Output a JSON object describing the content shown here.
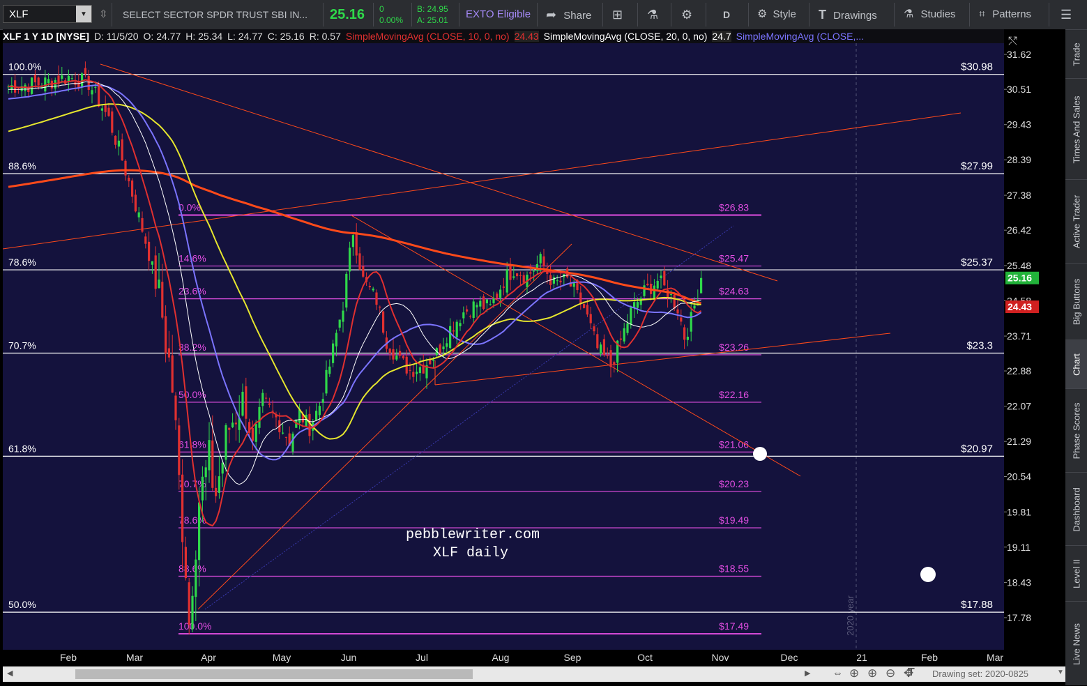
{
  "toolbar": {
    "symbol": "XLF",
    "description": "SELECT SECTOR SPDR TRUST SBI IN...",
    "last": "25.16",
    "change": "0",
    "change_pct": "0.00%",
    "bid": "B: 24.95",
    "ask": "A: 25.01",
    "exto": "EXTO Eligible",
    "share": "Share",
    "interval": "D",
    "style": "Style",
    "drawings": "Drawings",
    "studies": "Studies",
    "patterns": "Patterns",
    "icons": {
      "share": "share-icon",
      "grid": "layout-grid-icon",
      "flask": "flask-icon",
      "gear": "gear-icon",
      "style": "style-icon",
      "drawings": "drawing-tool-icon",
      "studies": "studies-flask-icon",
      "patterns": "patterns-icon",
      "menu": "hamburger-menu-icon"
    }
  },
  "infobar": {
    "title": "XLF 1 Y 1D [NYSE]",
    "date": "D: 11/5/20",
    "open": "O: 24.77",
    "high": "H: 25.34",
    "low": "L: 24.77",
    "close": "C: 25.16",
    "range": "R: 0.57",
    "sma10": "SimpleMovingAvg (CLOSE, 10, 0, no)",
    "sma10_value": "24.43",
    "sma20": "SimpleMovingAvg (CLOSE, 20, 0, no)",
    "sma20_value": "24.7",
    "sma_other": "SimpleMovingAvg (CLOSE,..."
  },
  "sidebar": {
    "tabs": [
      "Trade",
      "Times And Sales",
      "Active Trader",
      "Big Buttons",
      "Chart",
      "Phase Scores",
      "Dashboard",
      "Level II",
      "Live News"
    ],
    "active": "Chart"
  },
  "scrollbar": {
    "drawing_set": "Drawing set: 2020-0825"
  },
  "chart_data": {
    "type": "candlestick",
    "symbol": "XLF",
    "period": "1 Y 1D",
    "y_ticks": [
      31.62,
      30.51,
      29.43,
      28.39,
      27.38,
      26.42,
      25.48,
      24.58,
      23.71,
      22.88,
      22.07,
      21.29,
      20.54,
      19.81,
      19.11,
      18.43,
      17.78
    ],
    "ylim": [
      17.15,
      32.25
    ],
    "x_ticks": [
      "Feb",
      "Mar",
      "Apr",
      "May",
      "Jun",
      "Jul",
      "Aug",
      "Sep",
      "Oct",
      "Nov",
      "Dec",
      "21",
      "Feb",
      "Mar"
    ],
    "x_separator_label": "2020 year",
    "price_tags": {
      "last": "25.16",
      "sma10": "24.43"
    },
    "ohlc_last": {
      "date": "11/5/20",
      "open": 24.77,
      "high": 25.34,
      "low": 24.77,
      "close": 25.16
    },
    "fib_levels_major": [
      {
        "pct": "100.0%",
        "price": "$30.98"
      },
      {
        "pct": "88.6%",
        "price": "$27.99"
      },
      {
        "pct": "78.6%",
        "price": "$25.37"
      },
      {
        "pct": "70.7%",
        "price": "$23.3"
      },
      {
        "pct": "61.8%",
        "price": "$20.97"
      },
      {
        "pct": "50.0%",
        "price": "$17.88"
      }
    ],
    "fib_levels_minor": [
      {
        "pct": "0.0%",
        "price": "$26.83"
      },
      {
        "pct": "14.6%",
        "price": "$25.47"
      },
      {
        "pct": "23.6%",
        "price": "$24.63"
      },
      {
        "pct": "38.2%",
        "price": "$23.26"
      },
      {
        "pct": "50.0%",
        "price": "$22.16"
      },
      {
        "pct": "61.8%",
        "price": "$21.06"
      },
      {
        "pct": "70.7%",
        "price": "$20.23"
      },
      {
        "pct": "78.6%",
        "price": "$19.49"
      },
      {
        "pct": "88.6%",
        "price": "$18.55"
      },
      {
        "pct": "100.0%",
        "price": "$17.49"
      }
    ],
    "series": [
      {
        "name": "SimpleMovingAvg (CLOSE, 10, 0, no)",
        "color": "#e03030"
      },
      {
        "name": "SimpleMovingAvg (CLOSE, 20, 0, no)",
        "color": "#ffffff"
      },
      {
        "name": "SimpleMovingAvg (CLOSE,...",
        "color": "#7b74ff"
      }
    ],
    "annotations": [
      "pebblewriter.com",
      "XLF daily"
    ],
    "colors": {
      "background": "#14123d",
      "up": "#2fd84a",
      "down": "#e03030",
      "fib_major": "#ffffff",
      "fib_minor": "#e34ee3",
      "sma_yellow": "#e6e62e",
      "sma_red_thick": "#ff4a1a",
      "trend": "#ff4a1a"
    }
  }
}
